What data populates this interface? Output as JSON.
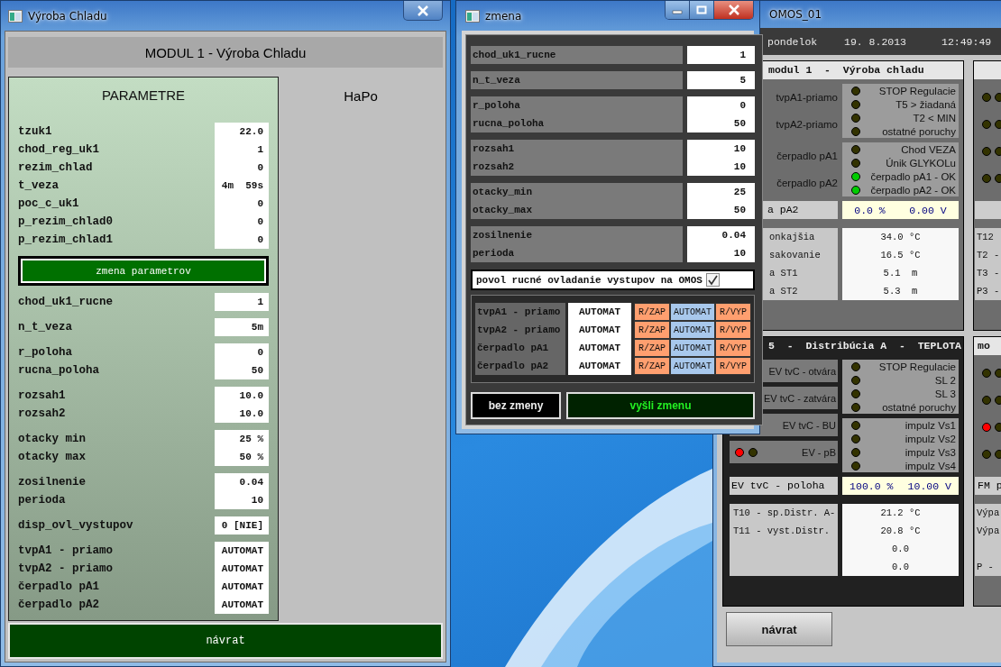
{
  "left_window": {
    "title": "Výroba Chladu",
    "header": "MODUL 1 - Výroba Chladu",
    "panel_title": "PARAMETRE",
    "side_title": "HaPo",
    "top_parameters": [
      {
        "label": "tzuk1",
        "value": "22.0"
      },
      {
        "label": "chod_reg_uk1",
        "value": "1"
      },
      {
        "label": "rezim_chlad",
        "value": "0"
      },
      {
        "label": "t_veza",
        "value": "4m  59s"
      },
      {
        "label": "poc_c_uk1",
        "value": "0"
      },
      {
        "label": "p_rezim_chlad0",
        "value": "0"
      },
      {
        "label": "p_rezim_chlad1",
        "value": "0"
      }
    ],
    "change_button": "zmena parametrov",
    "parameter_groups": [
      [
        {
          "label": "chod_uk1_rucne",
          "value": "1"
        }
      ],
      [
        {
          "label": "n_t_veza",
          "value": "5m"
        }
      ],
      [
        {
          "label": "r_poloha",
          "value": "0"
        },
        {
          "label": "rucna_poloha",
          "value": "50"
        }
      ],
      [
        {
          "label": "rozsah1",
          "value": "10.0"
        },
        {
          "label": "rozsah2",
          "value": "10.0"
        }
      ],
      [
        {
          "label": "otacky min",
          "value": "25 %"
        },
        {
          "label": "otacky max",
          "value": "50 %"
        }
      ],
      [
        {
          "label": "zosilnenie",
          "value": "0.04"
        },
        {
          "label": "perioda",
          "value": "10"
        }
      ],
      [
        {
          "label": "disp_ovl_vystupov",
          "value": "0 [NIE]"
        }
      ],
      [
        {
          "label": "tvpA1 - priamo",
          "value": "AUTOMAT"
        },
        {
          "label": "tvpA2 - priamo",
          "value": "AUTOMAT"
        },
        {
          "label": "čerpadlo pA1",
          "value": "AUTOMAT"
        },
        {
          "label": "čerpadlo pA2",
          "value": "AUTOMAT"
        }
      ]
    ],
    "return_button": "návrat"
  },
  "dialog": {
    "title": "zmena",
    "groups": [
      [
        {
          "label": "chod_uk1_rucne",
          "value": "1"
        }
      ],
      [
        {
          "label": "n_t_veza",
          "value": "5"
        }
      ],
      [
        {
          "label": "r_poloha",
          "value": "0"
        },
        {
          "label": "rucna_poloha",
          "value": "50"
        }
      ],
      [
        {
          "label": "rozsah1",
          "value": "10"
        },
        {
          "label": "rozsah2",
          "value": "10"
        }
      ],
      [
        {
          "label": "otacky_min",
          "value": "25"
        },
        {
          "label": "otacky_max",
          "value": "50"
        }
      ],
      [
        {
          "label": "zosilnenie",
          "value": "0.04"
        },
        {
          "label": "perioda",
          "value": "10"
        }
      ]
    ],
    "manual_control": {
      "label": "povol rucné ovladanie vystupov na OMOS",
      "checked": true
    },
    "outputs": [
      {
        "label": "tvpA1 - priamo",
        "state": "AUTOMAT",
        "buttons": [
          {
            "label": "R/ZAP",
            "selected": false
          },
          {
            "label": "AUTOMAT",
            "selected": true
          },
          {
            "label": "R/VYP",
            "selected": false
          }
        ]
      },
      {
        "label": "tvpA2 - priamo",
        "state": "AUTOMAT",
        "buttons": [
          {
            "label": "R/ZAP",
            "selected": false
          },
          {
            "label": "AUTOMAT",
            "selected": true
          },
          {
            "label": "R/VYP",
            "selected": false
          }
        ]
      },
      {
        "label": "čerpadlo pA1",
        "state": "AUTOMAT",
        "buttons": [
          {
            "label": "R/ZAP",
            "selected": false
          },
          {
            "label": "AUTOMAT",
            "selected": true
          },
          {
            "label": "R/VYP",
            "selected": false
          }
        ]
      },
      {
        "label": "čerpadlo pA2",
        "state": "AUTOMAT",
        "buttons": [
          {
            "label": "R/ZAP",
            "selected": false
          },
          {
            "label": "AUTOMAT",
            "selected": true
          },
          {
            "label": "R/VYP",
            "selected": false
          }
        ]
      }
    ],
    "cancel_button": "bez zmeny",
    "send_button": "vyšli zmenu"
  },
  "omos_window": {
    "title": "OMOS_01",
    "day": "pondelok",
    "date": "19. 8.2013",
    "time": "12:49:49",
    "panels": [
      {
        "kind": "module",
        "header": "modul 1  -  Výroba chladu",
        "left_items": [
          {
            "label": "tvpA1-priamo"
          },
          {
            "label": "tvpA2-priamo"
          },
          {
            "label": "čerpadlo pA1"
          },
          {
            "label": "čerpadlo pA2"
          }
        ],
        "status_groups": [
          [
            {
              "text": "STOP Regulacie",
              "color": "#333300"
            },
            {
              "text": "T5 > žiadaná",
              "color": "#333300"
            },
            {
              "text": "T2 < MIN",
              "color": "#333300"
            },
            {
              "text": "ostatné poruchy",
              "color": "#333300"
            }
          ],
          [
            {
              "text": "Chod VEZA",
              "color": "#333300"
            },
            {
              "text": "Únik GLYKOLu",
              "color": "#333300"
            },
            {
              "text": "čerpadlo pA1 - OK",
              "color": "#00cc00"
            },
            {
              "text": "čerpadlo pA2 - OK",
              "color": "#00cc00"
            }
          ]
        ],
        "position": {
          "label": "a pA2",
          "value": "0.0 %",
          "voltage": "0.00 V"
        },
        "measurements": [
          {
            "label": "onkajšia",
            "value": "34.0 °C"
          },
          {
            "label": "sakovanie",
            "value": "16.5 °C"
          },
          {
            "label": "a ST1",
            "value": "5.1  m"
          },
          {
            "label": "a ST2",
            "value": "5.3  m"
          }
        ]
      },
      {
        "kind": "distribution",
        "header": "5  -  Distribúcia A  -  TEPLOTA",
        "left_items": [
          {
            "label": "EV tvC - otvára"
          },
          {
            "label": "EV tvC - zatvára"
          },
          {
            "label": "EV tvC - BU"
          },
          {
            "label": "EV - pB",
            "leds": [
              {
                "color": "#ff0000"
              },
              {
                "color": "#333300"
              }
            ]
          }
        ],
        "status_groups": [
          [
            {
              "text": "STOP Regulacie",
              "color": "#333300"
            },
            {
              "text": "SL 2",
              "color": "#333300"
            },
            {
              "text": "SL 3",
              "color": "#333300"
            },
            {
              "text": "ostatné poruchy",
              "color": "#333300"
            }
          ],
          [
            {
              "text": "impulz Vs1",
              "color": "#333300"
            },
            {
              "text": "impulz Vs2",
              "color": "#333300"
            },
            {
              "text": "impulz Vs3",
              "color": "#333300"
            },
            {
              "text": "impulz Vs4",
              "color": "#333300"
            }
          ]
        ],
        "position": {
          "label": "EV tvC - poloha",
          "value": "100.0 %",
          "voltage": "10.00 V"
        },
        "measurements": [
          {
            "label": "T10 - sp.Distr. A-",
            "value": "21.2 °C"
          },
          {
            "label": "T11 - vyst.Distr.",
            "value": "20.8 °C"
          },
          {
            "value": "0.0"
          },
          {
            "value": "0.0"
          }
        ]
      }
    ],
    "partial_panels": [
      {
        "led_rows": [
          [
            {
              "color": "#333300"
            },
            {
              "color": "#333300"
            }
          ],
          [
            {
              "color": "#333300"
            },
            {
              "color": "#333300"
            }
          ],
          [
            {
              "color": "#333300"
            },
            {
              "color": "#333300"
            }
          ],
          [
            {
              "color": "#333300"
            },
            {
              "color": "#333300"
            }
          ]
        ],
        "measurement_labels": [
          "T12",
          "T2 -",
          "T3 -"
        ],
        "footer_label": "P3 -"
      },
      {
        "header": "mo",
        "led_rows": [
          [
            {
              "color": "#333300"
            },
            {
              "color": "#333300"
            }
          ],
          [
            {
              "color": "#333300"
            },
            {
              "color": "#333300"
            }
          ],
          [
            {
              "color": "#ff0000"
            },
            {
              "color": "#333300"
            }
          ],
          [
            {
              "color": "#333300"
            },
            {
              "color": "#333300"
            }
          ]
        ],
        "position_label": "FM p",
        "measurement_labels": [
          "Výpa",
          "Výpa"
        ],
        "footer_label": "P -"
      }
    ],
    "return_button": "návrat"
  }
}
